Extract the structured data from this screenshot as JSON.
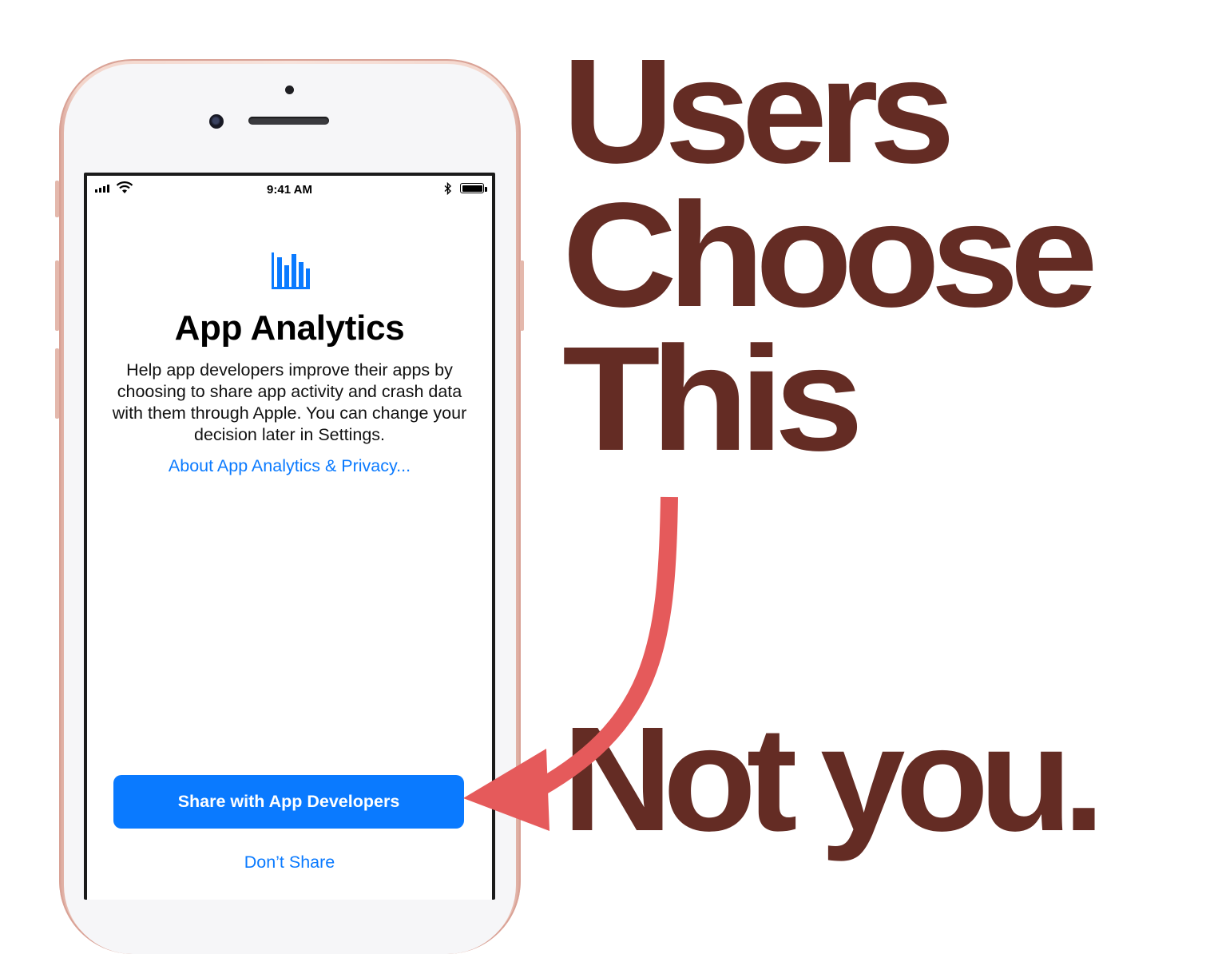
{
  "status_bar": {
    "time": "9:41 AM"
  },
  "screen": {
    "icon": "bar-chart-icon",
    "title": "App Analytics",
    "description": "Help app developers improve their apps by choosing to share app activity and crash data with them through Apple. You can change your decision later in Settings.",
    "privacy_link": "About App Analytics & Privacy...",
    "primary_button": "Share with App Developers",
    "secondary_button": "Don’t Share"
  },
  "headline": {
    "line1": "Users",
    "line2": "Choose",
    "line3": "This",
    "line4": "Not you."
  },
  "colors": {
    "headline": "#642c24",
    "arrow": "#e55a5b",
    "ios_blue": "#0a7aff",
    "phone_frame": "#f3d6cc"
  }
}
